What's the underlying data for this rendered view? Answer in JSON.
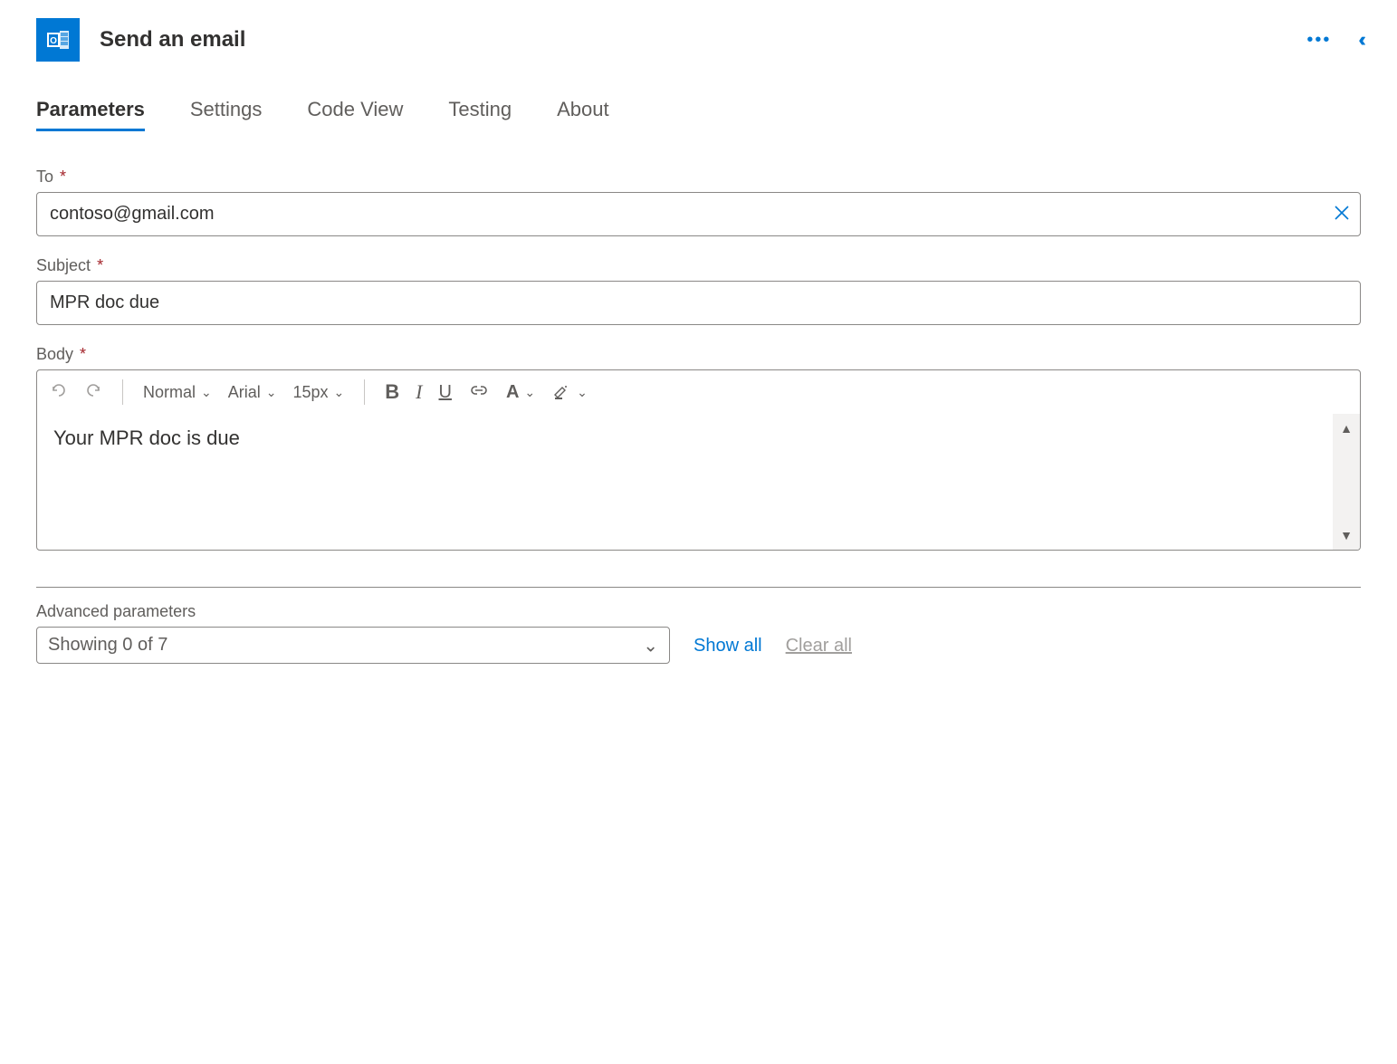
{
  "header": {
    "title": "Send an email",
    "icon": "outlook-icon"
  },
  "tabs": {
    "items": [
      {
        "label": "Parameters",
        "active": true
      },
      {
        "label": "Settings",
        "active": false
      },
      {
        "label": "Code View",
        "active": false
      },
      {
        "label": "Testing",
        "active": false
      },
      {
        "label": "About",
        "active": false
      }
    ]
  },
  "fields": {
    "to": {
      "label": "To",
      "value": "contoso@gmail.com",
      "required": true
    },
    "subject": {
      "label": "Subject",
      "value": "MPR doc due",
      "required": true
    },
    "body": {
      "label": "Body",
      "value": "Your MPR doc is due",
      "required": true
    }
  },
  "editor_toolbar": {
    "heading": "Normal",
    "font": "Arial",
    "size": "15px"
  },
  "advanced": {
    "label": "Advanced parameters",
    "select_text": "Showing 0 of 7",
    "show_all": "Show all",
    "clear_all": "Clear all"
  },
  "required_marker": "*",
  "colors": {
    "primary": "#0078d4",
    "text": "#323130",
    "muted": "#605e5c",
    "danger": "#a4262c"
  }
}
